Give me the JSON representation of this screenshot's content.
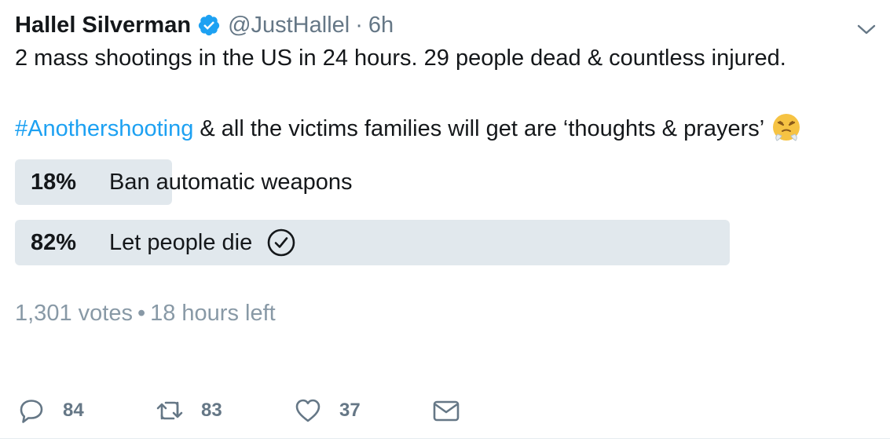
{
  "tweet": {
    "display_name": "Hallel Silverman",
    "handle": "@JustHallel",
    "separator": "·",
    "time": "6h",
    "text_line1": "2 mass shootings in the US in 24 hours. 29 people dead & countless injured.",
    "hashtag": "#Anothershooting",
    "text_line2_rest": " & all the victims families will get are ‘thoughts & prayers’"
  },
  "poll": {
    "options": [
      {
        "percent_label": "18%",
        "label": "Ban automatic weapons",
        "fraction": 0.18,
        "winner": false
      },
      {
        "percent_label": "82%",
        "label": "Let people die",
        "fraction": 0.82,
        "winner": true
      }
    ],
    "votes": "1,301 votes",
    "dot": "•",
    "time_left": "18 hours left"
  },
  "actions": {
    "reply_count": "84",
    "retweet_count": "83",
    "like_count": "37"
  },
  "icons": {
    "verified": "verified-badge-icon",
    "chevron": "chevron-down-icon",
    "emoji": "steam-from-nose-emoji",
    "check": "check-circle-icon",
    "reply": "reply-icon",
    "retweet": "retweet-icon",
    "like": "heart-icon",
    "dm": "envelope-icon"
  },
  "colors": {
    "link": "#1da1f2",
    "poll_bar": "#e1e8ed",
    "muted": "#657786",
    "text": "#14171a"
  }
}
